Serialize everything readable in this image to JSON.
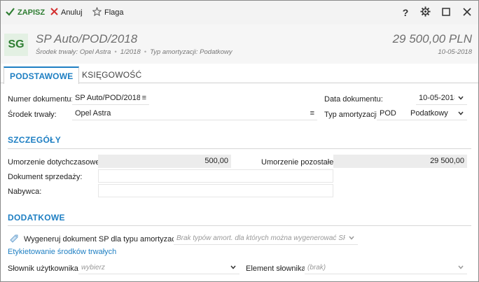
{
  "toolbar": {
    "save_label": "ZAPISZ",
    "cancel_label": "Anuluj",
    "flag_label": "Flaga",
    "help_label": "?"
  },
  "header": {
    "avatar": "SG",
    "title": "SP Auto/POD/2018",
    "asset": "Środek trwały: Opel Astra",
    "period": "1/2018",
    "amort_type": "Typ amortyzacji: Podatkowy",
    "amount": "29 500,00 PLN",
    "date": "10-05-2018"
  },
  "tabs": [
    {
      "label": "PODSTAWOWE"
    },
    {
      "label": "KSIĘGOWOŚĆ"
    }
  ],
  "form": {
    "doc_number_label": "Numer dokumentu:",
    "doc_number_value": "SP Auto/POD/2018",
    "asset_label": "Środek trwały:",
    "asset_value": "Opel Astra",
    "doc_date_label": "Data dokumentu:",
    "doc_date_value": "10-05-2018",
    "amort_label": "Typ amortyzacji:",
    "amort_code": "POD",
    "amort_value": "Podatkowy"
  },
  "details": {
    "section_title": "SZCZEGÓŁY",
    "prev_label": "Umorzenie dotychczasowe:",
    "prev_value": "500,00",
    "remaining_label": "Umorzenie pozostałe:",
    "remaining_value": "29 500,00",
    "sale_doc_label": "Dokument sprzedaży:",
    "buyer_label": "Nabywca:"
  },
  "extra": {
    "section_title": "DODATKOWE",
    "generate_label": "Wygeneruj dokument SP dla typu amortyzacji:",
    "generate_placeholder": "Brak typów amort. dla których można wygenerować SP",
    "labeling_link": "Etykietowanie środków trwałych",
    "dict_label": "Słownik użytkownika:",
    "dict_placeholder": "wybierz",
    "element_label": "Element słownika:",
    "element_placeholder": "(brak)"
  },
  "colors": {
    "accent": "#1e7fc3",
    "save_green": "#2e7d32",
    "cancel_red": "#d32f2f"
  },
  "icons": [
    "checkmark-icon",
    "close-icon",
    "star-icon",
    "help-icon",
    "gear-icon",
    "maximize-icon",
    "window-close-icon",
    "menu-icon",
    "chevron-down-icon",
    "tag-icon"
  ]
}
